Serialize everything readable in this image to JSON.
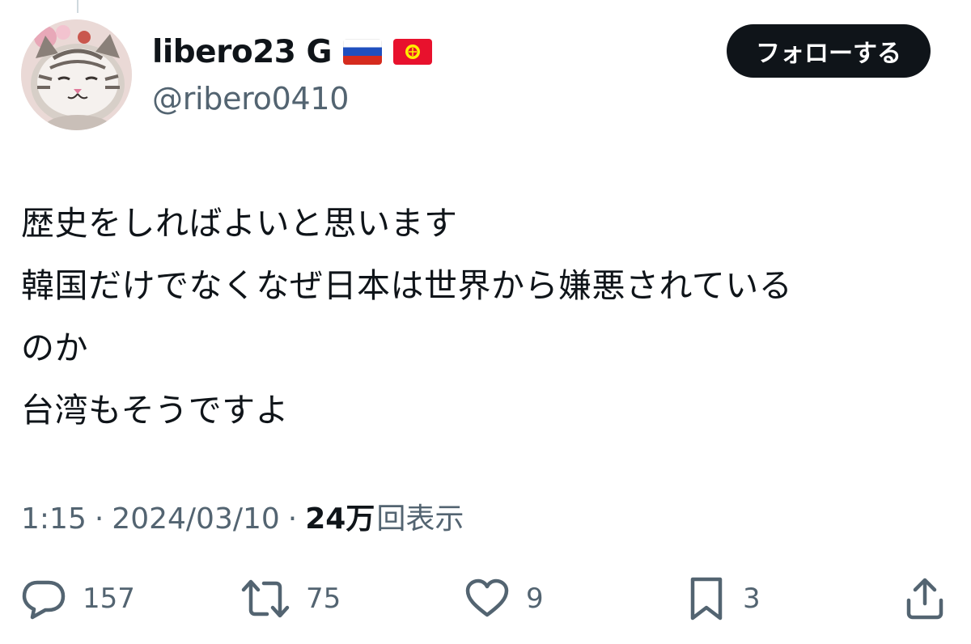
{
  "author": {
    "display_name": "libero23 G",
    "handle": "@ribero0410",
    "flags": [
      "flag-russia-icon",
      "flag-kyrgyzstan-icon"
    ]
  },
  "follow_label": "フォローする",
  "tweet": {
    "lines": [
      "歴史をしればよいと思います",
      "韓国だけでなくなぜ日本は世界から嫌悪されている",
      "のか",
      "台湾もそうですよ"
    ]
  },
  "meta": {
    "time": "1:15",
    "separator": "·",
    "date": "2024/03/10",
    "views_number": "24万",
    "views_label": "回表示"
  },
  "actions": {
    "replies": "157",
    "reposts": "75",
    "likes": "9",
    "bookmarks": "3"
  },
  "colors": {
    "text": "#0f1419",
    "secondary": "#536471",
    "button_bg": "#0f1419"
  }
}
